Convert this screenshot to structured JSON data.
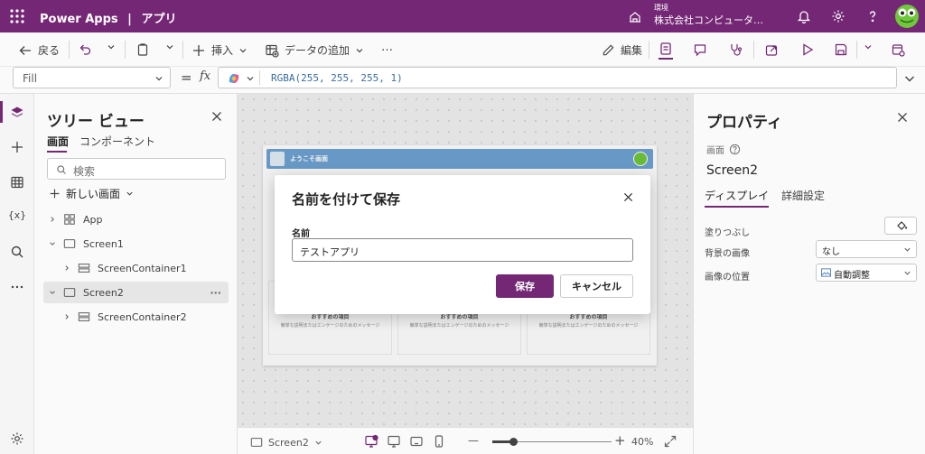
{
  "titlebar": {
    "app": "Power Apps",
    "separator": "|",
    "project": "アプリ",
    "env_label": "環境",
    "env_name": "株式会社コンピュータ…"
  },
  "commandbar": {
    "back": "戻る",
    "insert": "挿入",
    "add_data": "データの追加",
    "more": "…",
    "edit": "編集"
  },
  "formulabar": {
    "property": "Fill",
    "equals": "=",
    "fx": "fx",
    "formula": "RGBA(255, 255, 255, 1)"
  },
  "tree": {
    "title": "ツリー ビュー",
    "tabs": [
      "画面",
      "コンポーネント"
    ],
    "search_placeholder": "検索",
    "new_screen": "新しい画面",
    "items": [
      {
        "label": "App"
      },
      {
        "label": "Screen1"
      },
      {
        "label": "ScreenContainer1"
      },
      {
        "label": "Screen2"
      },
      {
        "label": "ScreenContainer2"
      }
    ],
    "item_more": "···"
  },
  "canvas": {
    "header_text": "ようこそ画面",
    "cards": [
      {
        "title": "おすすめの項目",
        "subtitle": "簡単な説明またはエンゲージのためのメッセージ"
      },
      {
        "title": "おすすめの項目",
        "subtitle": "簡単な説明またはエンゲージのためのメッセージ"
      },
      {
        "title": "おすすめの項目",
        "subtitle": "簡単な説明またはエンゲージのためのメッセージ"
      }
    ]
  },
  "bottombar": {
    "screen": "Screen2",
    "zoom_minus": "—",
    "zoom_plus": "+",
    "zoom": "40%",
    "zoom_level": 0.4
  },
  "properties": {
    "title": "プロパティ",
    "type": "画面",
    "name": "Screen2",
    "tabs": [
      "ディスプレイ",
      "詳細設定"
    ],
    "fill_label": "塗りつぶし",
    "bg_image_label": "背景の画像",
    "bg_image_value": "なし",
    "image_pos_label": "画像の位置",
    "image_pos_value": "自動調整"
  },
  "dialog": {
    "title": "名前を付けて保存",
    "name_label": "名前",
    "name_value": "テストアプリ",
    "save": "保存",
    "cancel": "キャンセル"
  },
  "colors": {
    "brand": "#742774",
    "app_header": "#6ea2d3"
  }
}
